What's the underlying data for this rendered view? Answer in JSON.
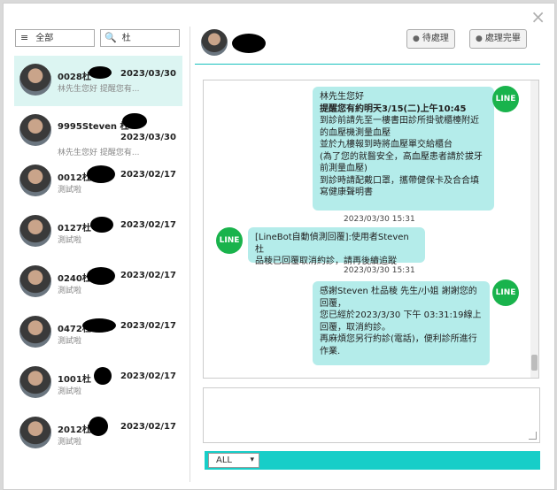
{
  "window": {
    "close_symbol": "×"
  },
  "filter": {
    "label": "全部",
    "menu_icon": "≡"
  },
  "search": {
    "value": "杜",
    "icon": "🔍"
  },
  "contacts": [
    {
      "name": "0028杜",
      "date": "2023/03/30",
      "preview": "林先生您好 提醒您有..."
    },
    {
      "name": "9995Steven 杜",
      "date": "2023/03/30",
      "preview": "林先生您好 提醒您有..."
    },
    {
      "name": "0012杜",
      "date": "2023/02/17",
      "preview": "測試啦"
    },
    {
      "name": "0127杜",
      "date": "2023/02/17",
      "preview": "測試啦"
    },
    {
      "name": "0240杜",
      "date": "2023/02/17",
      "preview": "測試啦"
    },
    {
      "name": "0472杜",
      "date": "2023/02/17",
      "preview": "測試啦"
    },
    {
      "name": "1001杜",
      "date": "2023/02/17",
      "preview": "測試啦"
    },
    {
      "name": "2012杜",
      "date": "2023/02/17",
      "preview": "測試啦"
    }
  ],
  "header": {
    "pending_label": "待處理",
    "done_label": "處理完畢"
  },
  "messages": [
    {
      "side": "right",
      "lines": [
        "林先生您好",
        "提醒您有約明天3/15(二)上午10:45",
        "到診前請先至一樓書田診所掛號櫃檯附近",
        "的血壓機測量血壓",
        "並於九樓報到時將血壓單交給櫃台",
        "(為了您的就醫安全，高血壓患者請於拔牙",
        "前測量血壓)",
        "到診時請配戴口罩，攜帶健保卡及合合填",
        "寫健康聲明書"
      ],
      "time": "2023/03/30 15:31",
      "badge": "LINE"
    },
    {
      "side": "left",
      "lines": [
        "[LineBot自動偵測回覆]:使用者Steven 杜",
        "品稜已回覆取消約診，請再後續追蹤"
      ],
      "time": "2023/03/30 15:31",
      "badge": "LINE"
    },
    {
      "side": "right",
      "lines": [
        "感謝Steven 杜品稜 先生/小姐 謝謝您的",
        "回覆，",
        "您已經於2023/3/30 下午 03:31:19線上",
        "回覆，取消約診。",
        "再麻煩您另行約診(電話)，便利診所進行",
        "作業."
      ],
      "badge": "LINE"
    }
  ],
  "composer": {
    "value": ""
  },
  "channel_select": {
    "value": "ALL"
  },
  "colors": {
    "accent": "#17cec8",
    "bubble": "#b4ecea",
    "line_green": "#19b34c",
    "active_row": "#dcf5f2"
  }
}
